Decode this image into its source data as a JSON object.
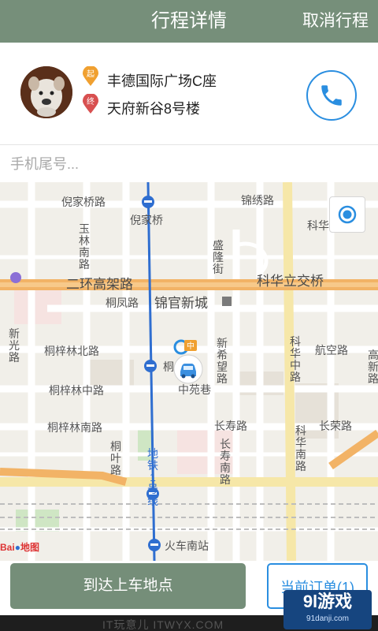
{
  "header": {
    "title": "行程详情",
    "cancel_label": "取消行程"
  },
  "trip": {
    "start_badge": "起",
    "end_badge": "终",
    "start_address": "丰德国际广场C座",
    "end_address": "天府新谷8号楼"
  },
  "phone_tail": {
    "placeholder": "手机尾号..."
  },
  "map": {
    "labels": {
      "nijiaqiao_road": "倪家桥路",
      "nijiaqiao_station": "倪家桥",
      "jinxiu_road": "锦绣路",
      "kehua_road_top": "科华路",
      "yulin_nan_road": "玉林南路",
      "shenglong_street": "盛隆街",
      "second_ring": "二环高架路",
      "kehua_li_bridge": "科华立交桥",
      "tongfeng_road": "桐凤路",
      "jinguan_city": "锦官新城",
      "xinguang_road": "新光路",
      "tongzilin_bei": "桐梓林北路",
      "tong_station": "桐",
      "xinximang_road": "新希望路",
      "kehua_zhong_road": "科华中路",
      "hangkong_road": "航空路",
      "gaoxin_road": "高新路",
      "tongzilin_zhong": "桐梓林中路",
      "zhongyuan_lane": "中苑巷",
      "changshou_road": "长寿路",
      "changrong_road": "长荣路",
      "tongzilin_nan": "桐梓林南路",
      "tongye_road": "桐叶路",
      "changshou_nan_road": "长寿南路",
      "kehua_nan_road": "科华南路",
      "metro_line1": "地铁1号线",
      "huochenan_station": "火车南站",
      "pickup_marker": "中",
      "map_logo_brand": "Bai",
      "map_logo_suffix": "地图"
    }
  },
  "actions": {
    "arrive_label": "到达上车地点",
    "current_order_label": "当前订单(1)"
  },
  "watermark": {
    "text": "IT玩意儿 ITWYX.COM",
    "logo_main": "9l游戏",
    "logo_sub": "91danji.com"
  },
  "colors": {
    "header_bg": "#768f7a",
    "accent_blue": "#2a8ee0",
    "arrive_button": "#758e79",
    "start_pin": "#f0a030",
    "end_pin": "#d85050",
    "expressway": "#f2b366"
  }
}
